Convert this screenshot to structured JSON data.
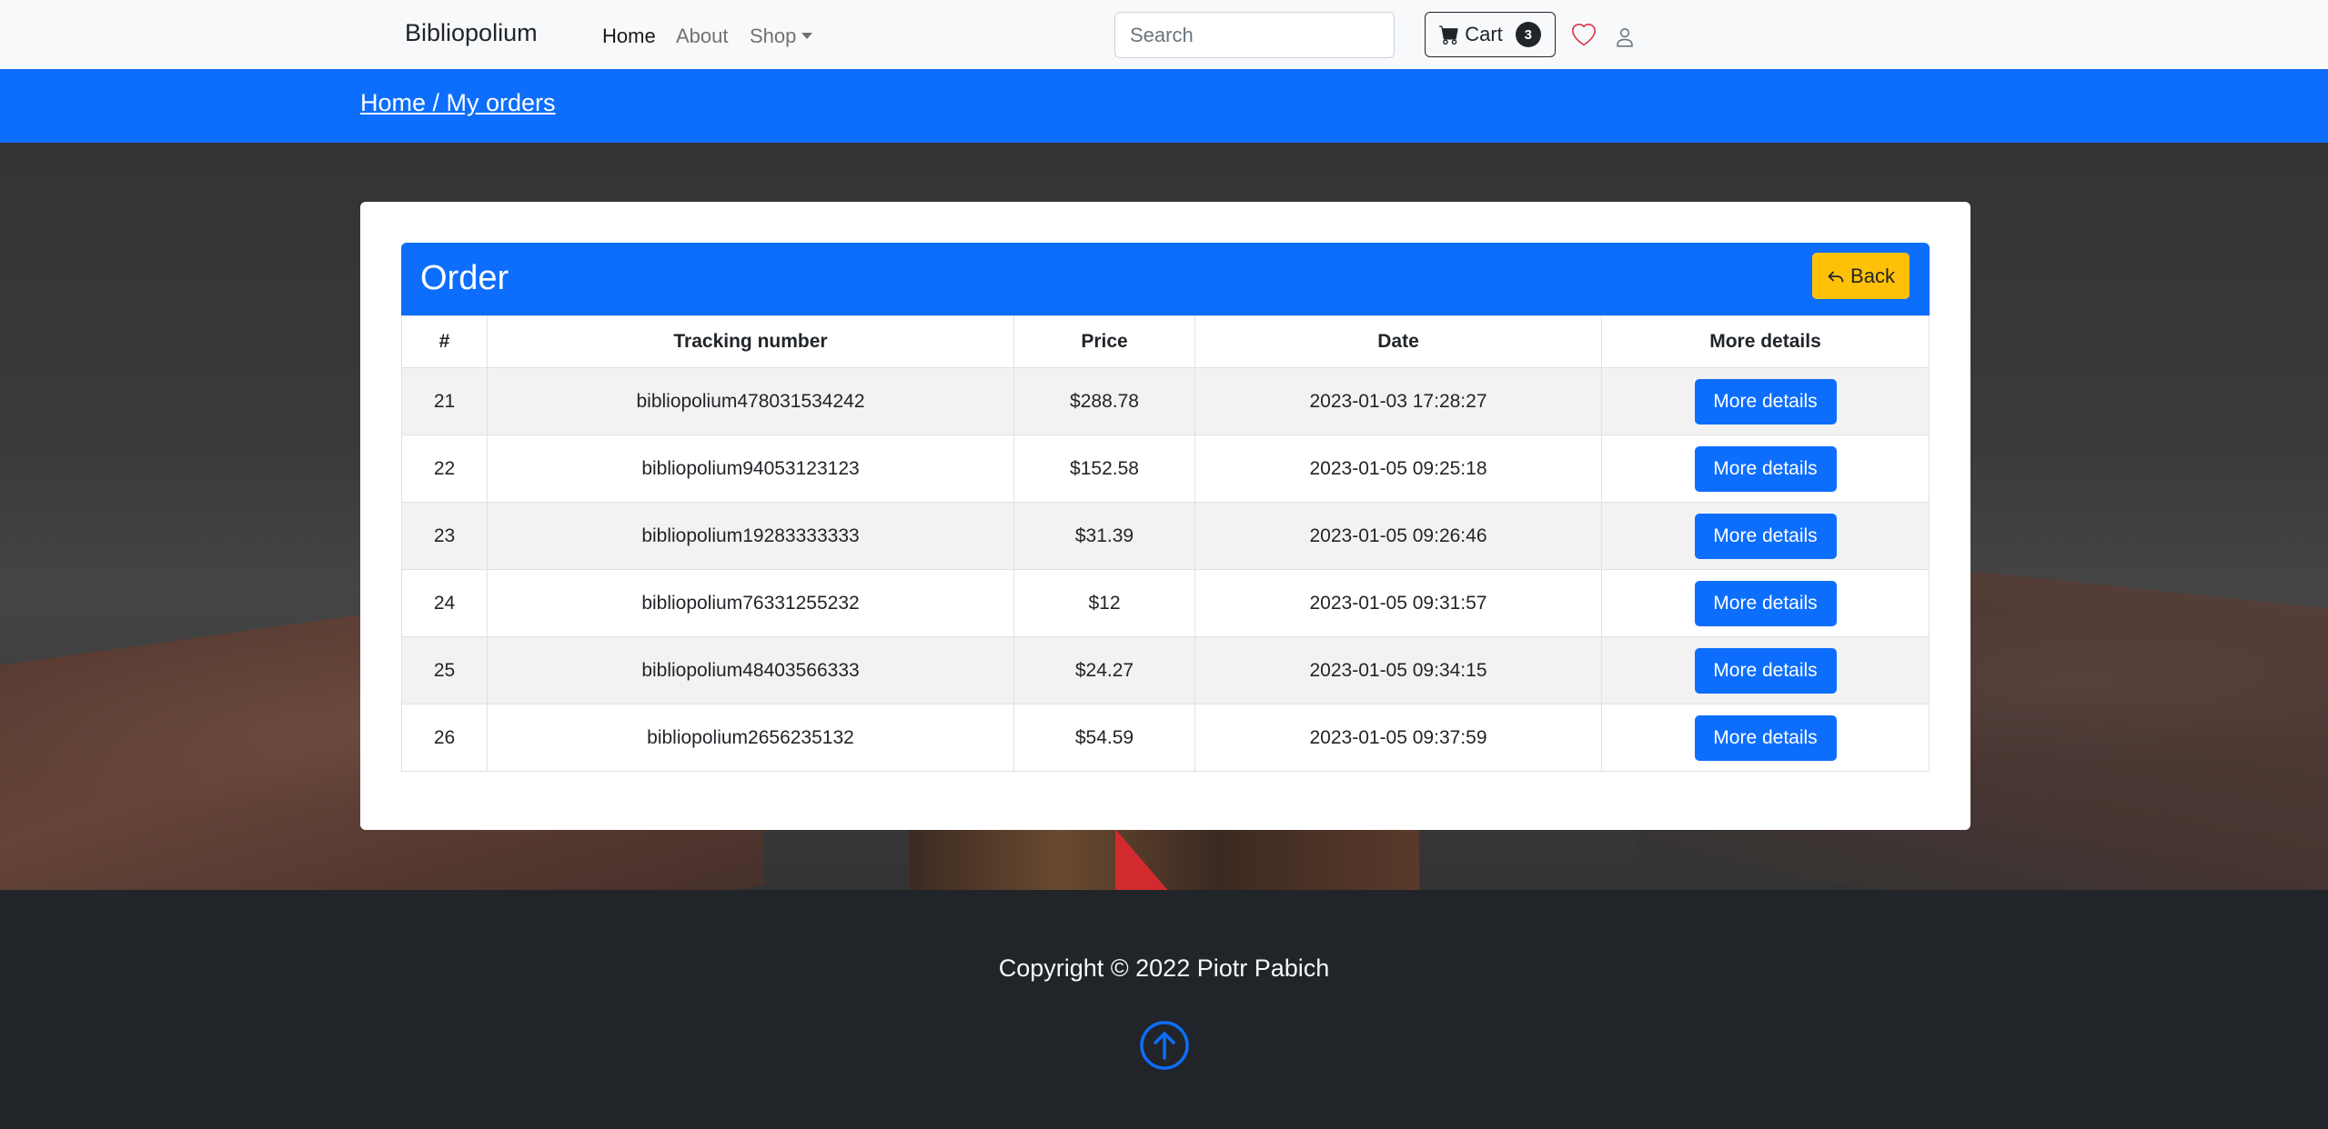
{
  "navbar": {
    "brand": "Bibliopolium",
    "links": [
      {
        "label": "Home",
        "active": true
      },
      {
        "label": "About",
        "active": false
      },
      {
        "label": "Shop",
        "active": false,
        "dropdown": true
      }
    ],
    "search_placeholder": "Search",
    "search_value": "",
    "cart_label": "Cart",
    "cart_count": "3",
    "icons": [
      "cart-icon",
      "heart-icon",
      "user-icon"
    ]
  },
  "breadcrumb": {
    "text": "Home / My orders"
  },
  "order": {
    "title": "Order",
    "back_label": "Back",
    "columns": [
      "#",
      "Tracking number",
      "Price",
      "Date",
      "More details"
    ],
    "rows": [
      {
        "id": "21",
        "tracking": "bibliopolium478031534242",
        "price": "$288.78",
        "date": "2023-01-03 17:28:27",
        "action": "More details"
      },
      {
        "id": "22",
        "tracking": "bibliopolium94053123123",
        "price": "$152.58",
        "date": "2023-01-05 09:25:18",
        "action": "More details"
      },
      {
        "id": "23",
        "tracking": "bibliopolium19283333333",
        "price": "$31.39",
        "date": "2023-01-05 09:26:46",
        "action": "More details"
      },
      {
        "id": "24",
        "tracking": "bibliopolium76331255232",
        "price": "$12",
        "date": "2023-01-05 09:31:57",
        "action": "More details"
      },
      {
        "id": "25",
        "tracking": "bibliopolium48403566333",
        "price": "$24.27",
        "date": "2023-01-05 09:34:15",
        "action": "More details"
      },
      {
        "id": "26",
        "tracking": "bibliopolium2656235132",
        "price": "$54.59",
        "date": "2023-01-05 09:37:59",
        "action": "More details"
      }
    ]
  },
  "footer": {
    "copyright": "Copyright © 2022 Piotr Pabich",
    "scroll_top_icon": "arrow-up-circle-icon"
  },
  "colors": {
    "primary": "#0d6efd",
    "warning": "#ffc107",
    "dark": "#212529",
    "light": "#f8f9fa",
    "heart": "#dc3545"
  }
}
